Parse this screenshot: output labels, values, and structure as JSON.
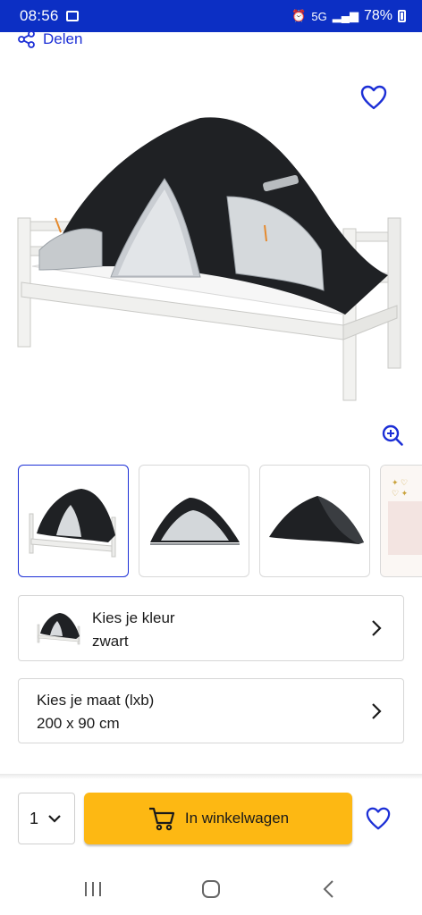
{
  "status_bar": {
    "time": "08:56",
    "network": "5G",
    "battery": "78%"
  },
  "share": {
    "label": "Delen"
  },
  "product": {
    "main_image": "tent-bed-black-icon",
    "thumbnails": [
      "tent-bed-thumb-1",
      "tent-bed-thumb-2",
      "tent-bed-thumb-3",
      "tent-bed-thumb-4"
    ]
  },
  "options": {
    "color": {
      "label": "Kies je kleur",
      "value": "zwart"
    },
    "size": {
      "label": "Kies je maat (lxb)",
      "value": "200 x 90 cm"
    }
  },
  "actions": {
    "quantity": "1",
    "add_to_cart": "In winkelwagen"
  },
  "colors": {
    "brand_blue": "#0c2fc4",
    "accent_blue": "#1c2fd6",
    "cart_yellow": "#fdb813"
  }
}
